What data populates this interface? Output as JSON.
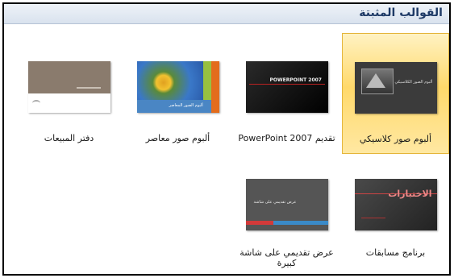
{
  "header": {
    "title": "القوالب المثبتة"
  },
  "templates": [
    {
      "caption": "ألبوم صور كلاسيكي",
      "thumb_text": "ألبوم الصور الكلاسيكي"
    },
    {
      "caption": "تقديم PowerPoint 2007",
      "thumb_text": "POWERPOINT 2007"
    },
    {
      "caption": "ألبوم صور معاصر",
      "thumb_text": "ألبوم الصور المعاصر"
    },
    {
      "caption": "دفتر المبيعات",
      "thumb_text": ""
    },
    {
      "caption": "برنامج مسابقات",
      "thumb_text": "الاختبارات"
    },
    {
      "caption": "عرض تقديمي على شاشة كبيرة",
      "thumb_text": "عرض تقديمي على شاشة"
    }
  ],
  "colors": {
    "selected_bg": "#ffd96b",
    "header_text": "#1e3a66"
  }
}
